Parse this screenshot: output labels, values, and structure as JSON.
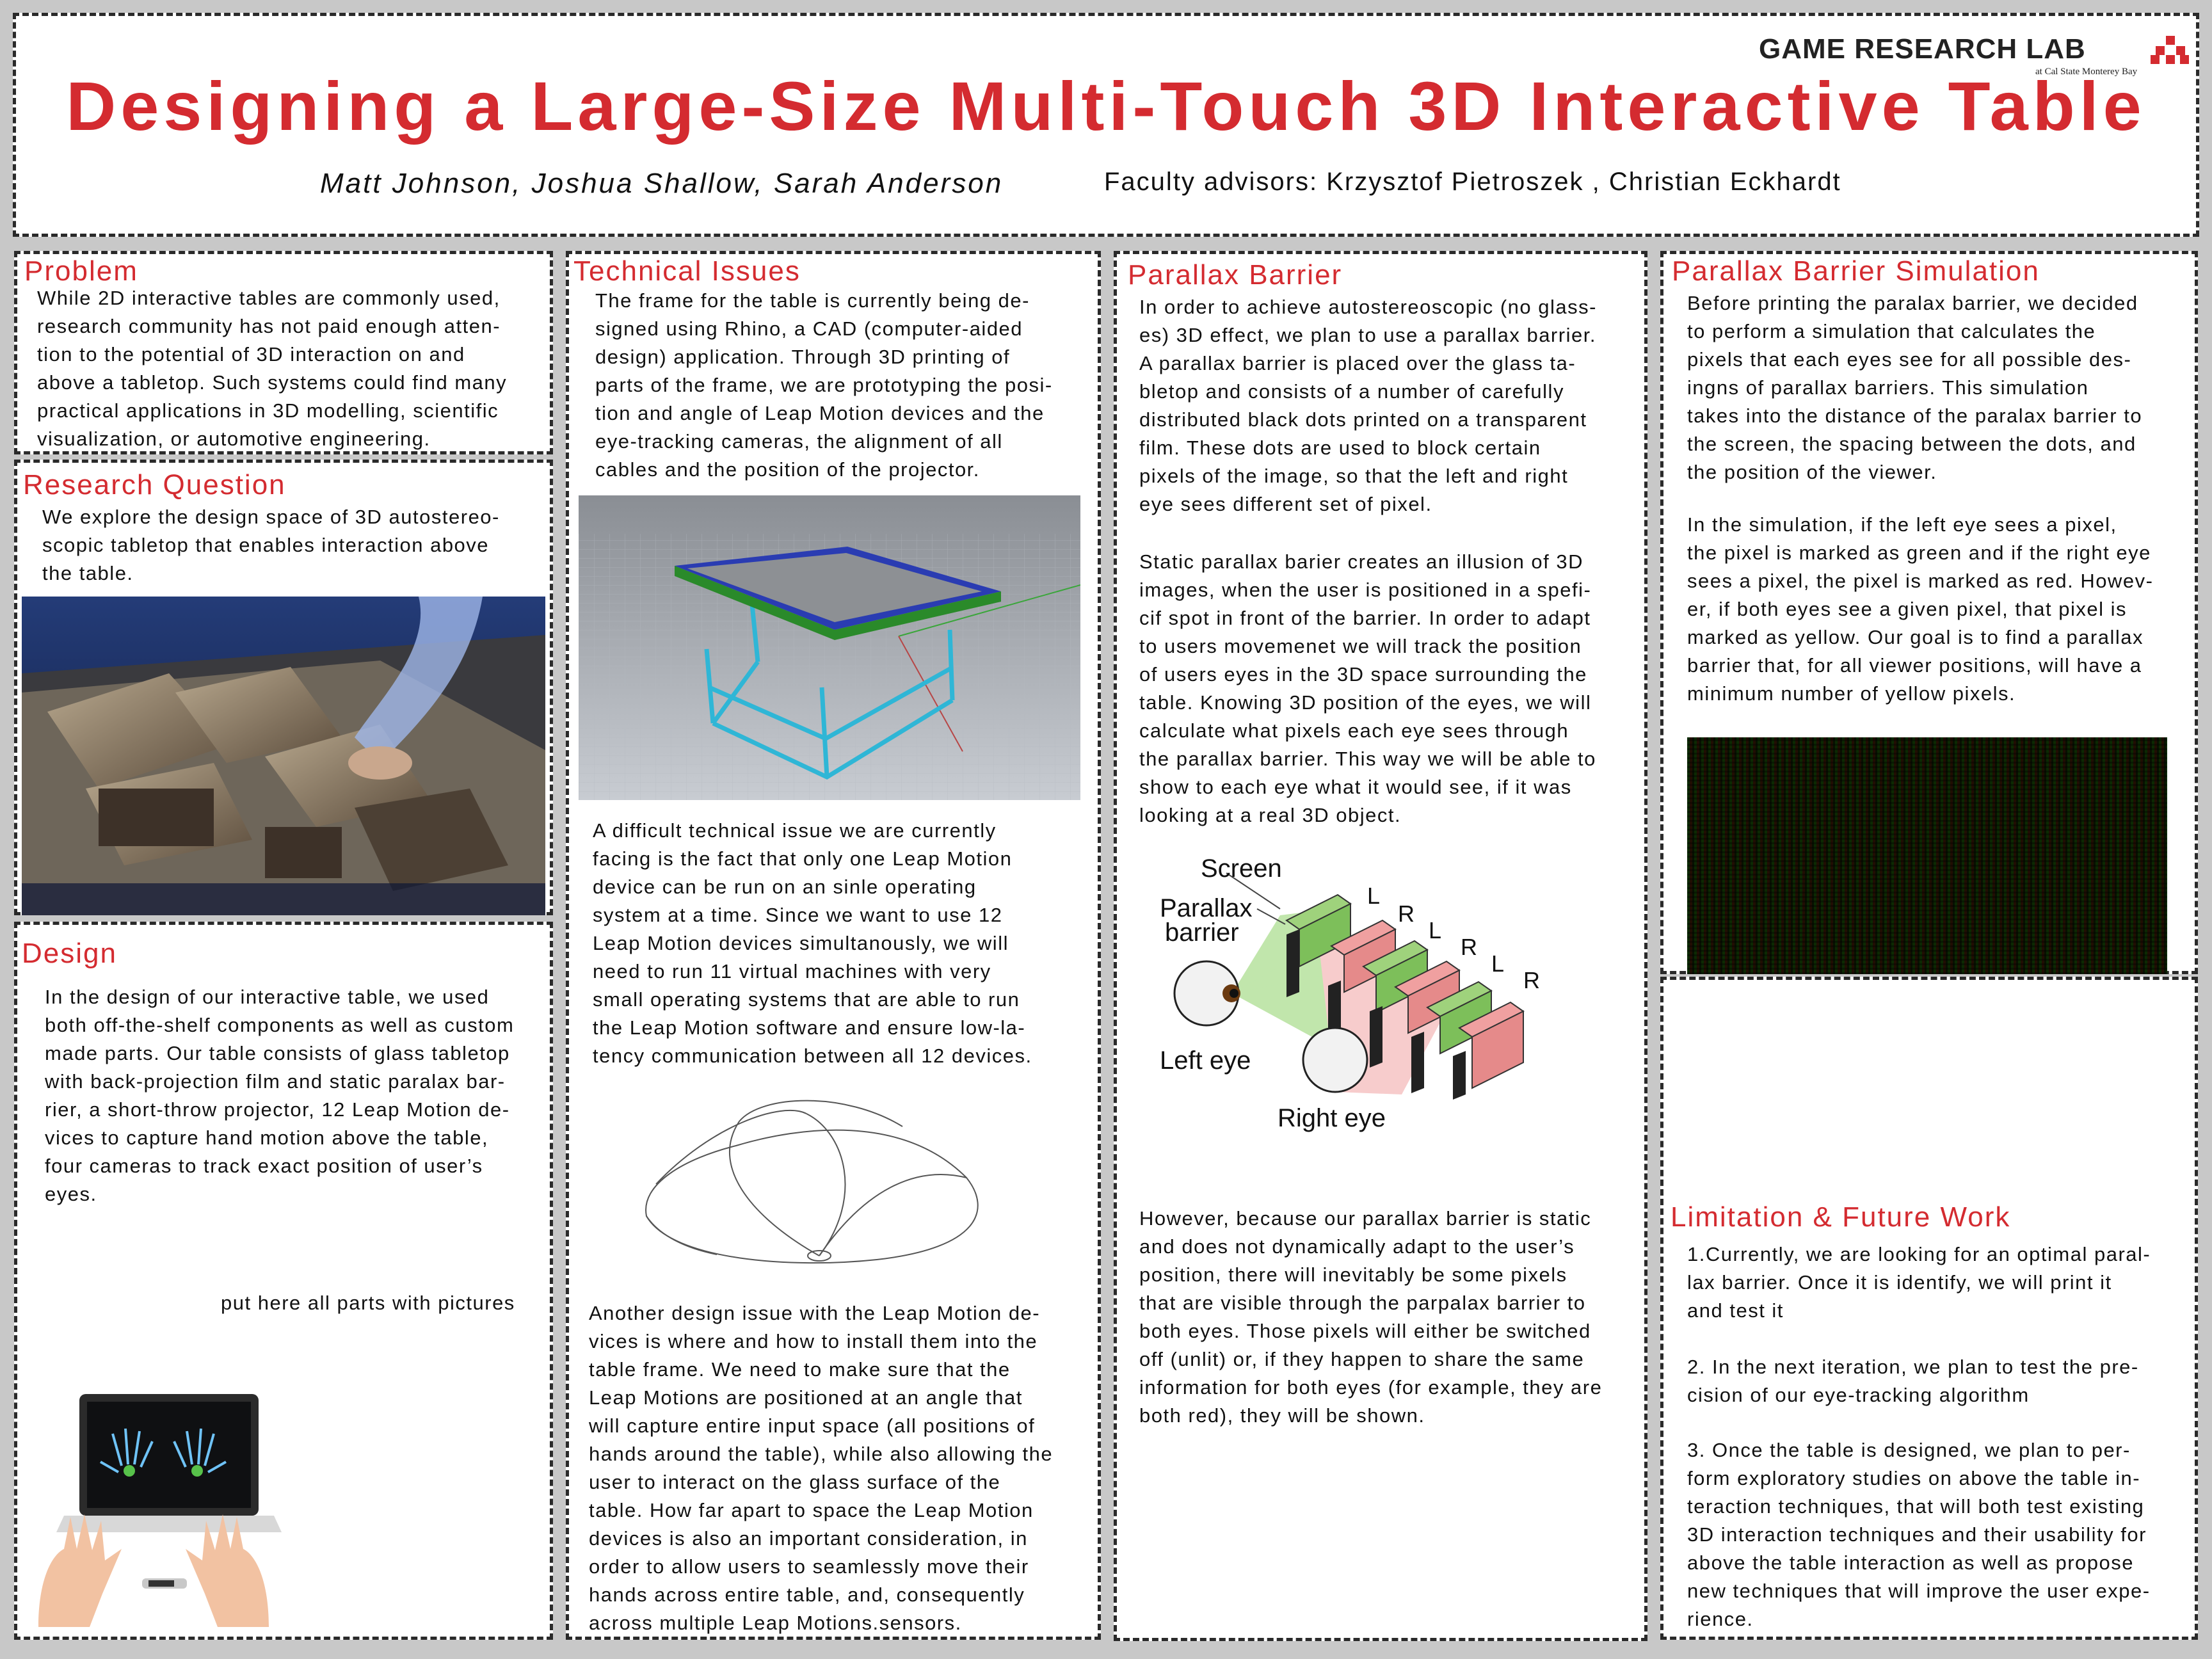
{
  "header": {
    "title": "Designing a Large-Size Multi-Touch 3D Interactive Table",
    "authors": "Matt Johnson, Joshua Shallow, Sarah Anderson",
    "advisors": "Faculty advisors: Krzysztof Pietroszek , Christian Eckhardt",
    "lab_name": "GAME RESEARCH LAB",
    "lab_sub": "at Cal State Monterey Bay"
  },
  "problem": {
    "heading": "Problem",
    "text": "While 2D interactive tables are commonly used,\nresearch community has not paid enough atten-\ntion to the potential of 3D interaction on and\nabove a tabletop. Such systems could find many\npractical applications in 3D modelling, scientific\nvisualization, or automotive engineering."
  },
  "research_question": {
    "heading": "Research Question",
    "text": "We explore the design space of 3D autostereo-\nscopic tabletop that enables interaction above\nthe table."
  },
  "design": {
    "heading": "Design",
    "text": "In the design of our interactive table, we used\nboth off-the-shelf components as well as custom\nmade parts. Our table consists of glass tabletop\nwith back-projection film and static paralax bar-\nrier, a short-throw projector, 12 Leap Motion de-\nvices to capture hand motion above the table,\nfour cameras to track exact position of user’s\neyes.",
    "note": "put here all parts with pictures"
  },
  "technical_issues": {
    "heading": "Technical Issues",
    "text1": "The frame for the table is currently being de-\nsigned using Rhino, a CAD (computer-aided\ndesign) application. Through 3D printing of\nparts of the frame, we are prototyping the posi-\ntion and angle of Leap Motion devices and the\neye-tracking cameras, the alignment of all\ncables and the position of the projector.",
    "text2": "A difficult technical issue we are currently\nfacing is the fact that only one Leap Motion\ndevice can be run on an sinle operating\nsystem at a time. Since we want to use 12\nLeap Motion devices simultanously, we will\nneed to run 11 virtual machines with very\nsmall operating systems that are able to run\nthe Leap Motion software and ensure low-la-\ntency communication between all 12 devices.",
    "text3": "Another design issue with the Leap Motion de-\nvices is where and how to install them into the\ntable frame. We need to make sure that the\nLeap Motions are positioned at an angle that\nwill capture entire input space (all positions of\nhands around the table), while also allowing the\nuser to interact on the glass surface of the\ntable. How far apart to space the Leap Motion\ndevices is also an important consideration, in\norder to allow users to seamlessly move their\nhands across entire table, and, consequently\nacross multiple Leap Motions.sensors."
  },
  "parallax_barrier": {
    "heading": "Parallax Barrier",
    "text1": "In order to achieve autostereoscopic (no glass-\nes) 3D effect, we plan to use a parallax barrier.\nA parallax barrier is placed over the glass ta-\nbletop and consists of a number of carefully\ndistributed black dots printed on a transparent\nfilm. These dots are used to block certain\npixels of the image, so that the left and right\neye sees different set of pixel.",
    "text2": "Static parallax barier creates an illusion of 3D\nimages, when the user is positioned in a spefi-\ncif spot in front of the barrier. In order to adapt\nto users movemenet we will track the position\nof users eyes in the 3D space surrounding the\ntable. Knowing 3D position of the eyes, we will\ncalculate what pixels each eye sees through\nthe parallax barrier. This way we will be able to\nshow to each eye what it would see, if it was\nlooking at a real 3D object.",
    "text3": "However, because our parallax barrier is static\nand does not dynamically adapt to the user’s\nposition, there will inevitably be some pixels\nthat are visible through the parpalax barrier to\nboth eyes. Those pixels will either be switched\noff (unlit) or, if they happen to share the same\ninformation for both eyes (for example, they are\nboth red), they will be shown.",
    "diagram": {
      "screen": "Screen",
      "barrier_line1": "Parallax",
      "barrier_line2": "barrier",
      "left_eye": "Left eye",
      "right_eye": "Right eye",
      "L1": "L",
      "R1": "R",
      "L2": "L",
      "R2": "R",
      "L3": "L",
      "R3": "R"
    }
  },
  "simulation": {
    "heading": "Parallax Barrier Simulation",
    "text1": "Before printing the paralax barrier, we decided\nto perform a simulation that calculates the\npixels that each eyes see for all possible des-\ningns of  parallax barriers. This simulation\ntakes into the distance of the paralax barrier to\nthe screen, the spacing between the dots, and\nthe position of the viewer.",
    "text2": "In the simulation, if the left eye sees a pixel,\nthe pixel is marked as green and if the right eye\nsees a pixel, the pixel is marked as red. Howev-\ner, if both eyes see a given pixel, that pixel is\nmarked as yellow. Our goal is to find a parallax\nbarrier that, for all viewer positions, will have a\nminimum number of yellow pixels."
  },
  "limitation": {
    "heading": "Limitation & Future Work",
    "text1": "1.Currently, we are looking for an optimal paral-\nlax barrier. Once it is identify, we will print it\nand test it",
    "text2": "2. In the next iteration, we plan to test the pre-\ncision of our eye-tracking algorithm",
    "text3": "3. Once the table is designed, we plan to per-\nform exploratory studies on above the table in-\nteraction techniques, that will both test existing\n3D interaction techniques and their usability for\nabove the table interaction as well as propose\nnew techniques that will improve the user expe-\nrience."
  },
  "colors": {
    "accent": "#d42b30",
    "text": "#111111",
    "background": "#c8c8c8"
  }
}
